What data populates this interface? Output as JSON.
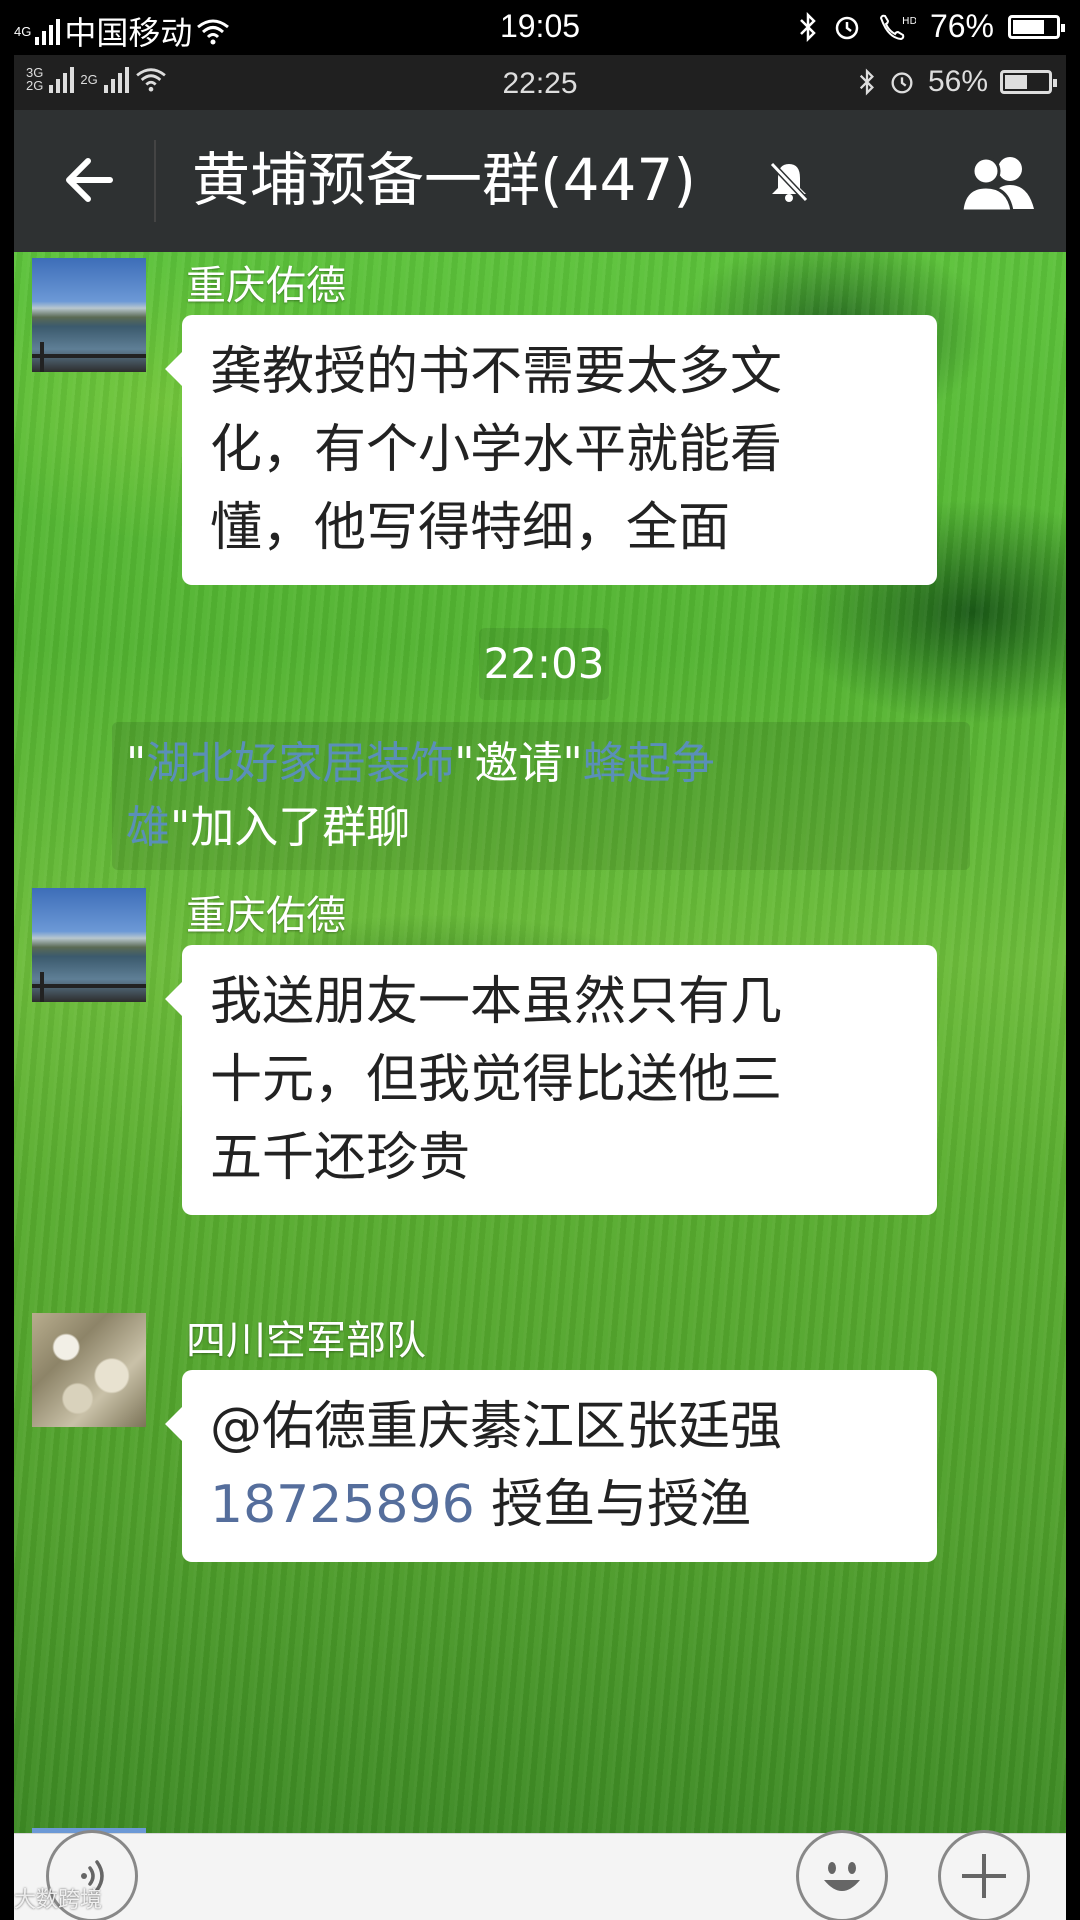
{
  "outer_status": {
    "carrier": "中国移动",
    "network": "4G",
    "time": "19:05",
    "battery": "76%",
    "battery_level": 0.76
  },
  "inner_status": {
    "net1": "3G",
    "net1b": "2G",
    "net2": "2G",
    "time": "22:25",
    "battery": "56%",
    "battery_level": 0.56
  },
  "header": {
    "title": "黄埔预备一群(447)",
    "muted": true
  },
  "messages": [
    {
      "sender": "重庆佑德",
      "avatar": "city-river-photo",
      "lines": [
        "龚教授的书不需要太多文",
        "化，有个小学水平就能看",
        "懂，他写得特细，全面"
      ]
    },
    {
      "sender": "重庆佑德",
      "avatar": "city-river-photo",
      "lines": [
        "我送朋友一本虽然只有几",
        "十元，但我觉得比送他三",
        "五千还珍贵"
      ]
    },
    {
      "sender": "四川空军部队",
      "avatar": "stone-photo",
      "line1": "@佑德重庆綦江区张廷强",
      "line2_number": "18725896",
      "line2_text": " 授鱼与授渔"
    }
  ],
  "timestamp": "22:03",
  "system_notice": {
    "q1": "\"",
    "inviter": "湖北好家居装饰",
    "mid": "\"邀请\"",
    "invitee_part1": "蜂起争",
    "invitee_part2": "雄",
    "tail": "\"加入了群聊"
  },
  "watermark": "大数跨境",
  "colors": {
    "titlebar": "#2e3132",
    "link": "#556e9c",
    "system_name": "#5a8fb8"
  }
}
